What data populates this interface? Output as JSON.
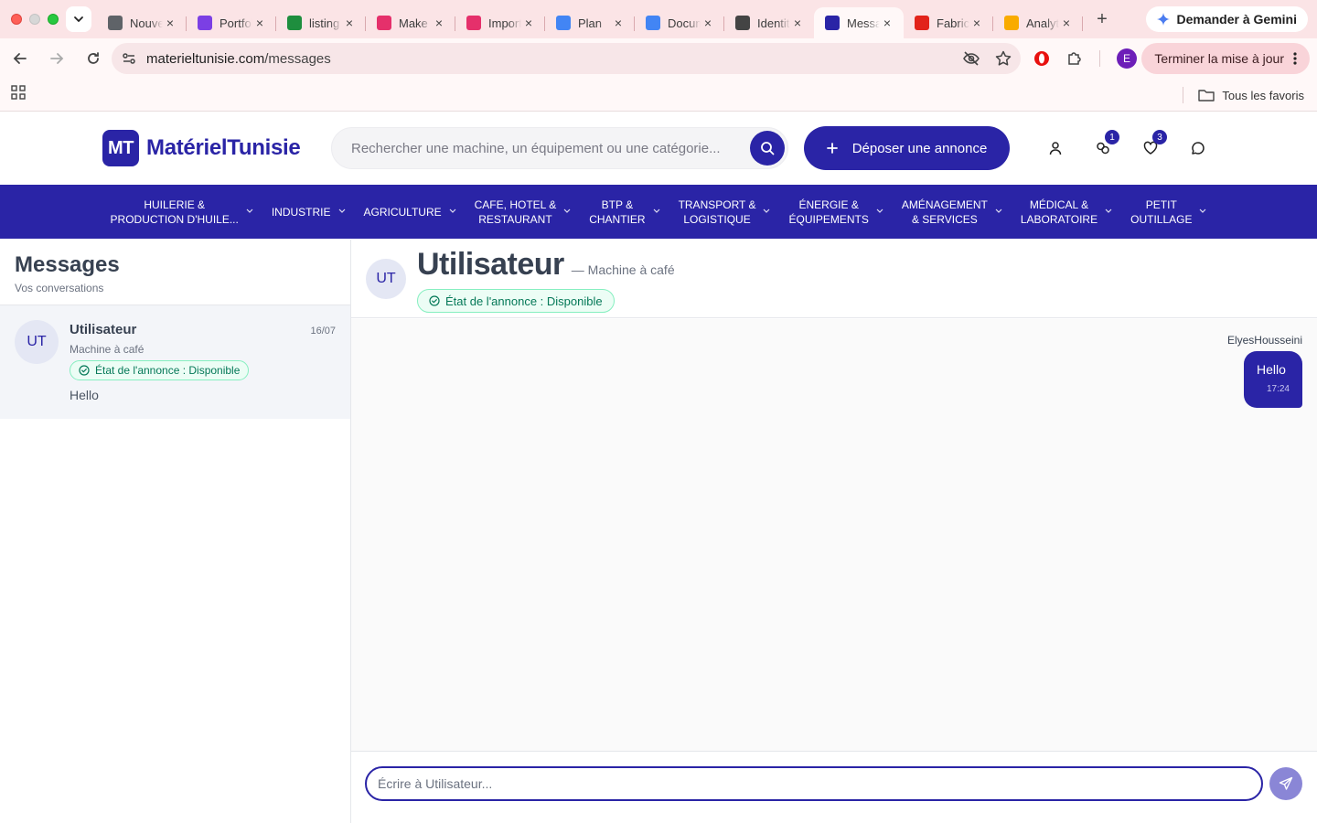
{
  "browser": {
    "tabs": [
      {
        "label": "Nouvel onglet",
        "icon": "chrome-icon",
        "color": "#5f6368"
      },
      {
        "label": "Portfolio",
        "icon": "h-logo-icon",
        "color": "#7b3fe4"
      },
      {
        "label": "listing",
        "icon": "sheet-icon",
        "color": "#1e8e3e"
      },
      {
        "label": "Make",
        "icon": "flow-icon",
        "color": "#e5306b"
      },
      {
        "label": "Import",
        "icon": "flow-icon",
        "color": "#e5306b"
      },
      {
        "label": "Plan",
        "icon": "doc-icon",
        "color": "#4285f4"
      },
      {
        "label": "Document",
        "icon": "doc-icon",
        "color": "#4285f4"
      },
      {
        "label": "Identité",
        "icon": "openai-icon",
        "color": "#444"
      },
      {
        "label": "Messages",
        "icon": "mt-icon",
        "color": "#2a24a6"
      },
      {
        "label": "Fabric",
        "icon": "t-icon",
        "color": "#e2231a"
      },
      {
        "label": "Analytics",
        "icon": "analytics-icon",
        "color": "#f9ab00"
      }
    ],
    "active_tab": 8,
    "gemini_label": "Demander à Gemini",
    "url_host": "materieltunisie.com",
    "url_path": "/messages",
    "update_label": "Terminer la mise à jour",
    "profile_initial": "E",
    "bookmarks_all_label": "Tous les favoris"
  },
  "site": {
    "logo_mark": "MT",
    "logo_text": "MatérielTunisie",
    "search_placeholder": "Rechercher une machine, un équipement ou une catégorie...",
    "post_label": "Déposer une annonce",
    "badges": {
      "compare": "1",
      "favorites": "3"
    }
  },
  "categories": [
    {
      "line1": "HUILERIE &",
      "line2": "PRODUCTION D'HUILE..."
    },
    {
      "line1": "INDUSTRIE",
      "line2": ""
    },
    {
      "line1": "AGRICULTURE",
      "line2": ""
    },
    {
      "line1": "CAFE, HOTEL &",
      "line2": "RESTAURANT"
    },
    {
      "line1": "BTP &",
      "line2": "CHANTIER"
    },
    {
      "line1": "TRANSPORT &",
      "line2": "LOGISTIQUE"
    },
    {
      "line1": "ÉNERGIE &",
      "line2": "ÉQUIPEMENTS"
    },
    {
      "line1": "AMÉNAGEMENT",
      "line2": "& SERVICES"
    },
    {
      "line1": "MÉDICAL &",
      "line2": "LABORATOIRE"
    },
    {
      "line1": "PETIT",
      "line2": "OUTILLAGE"
    }
  ],
  "messages": {
    "title": "Messages",
    "subtitle": "Vos conversations",
    "conversation": {
      "initials": "UT",
      "name": "Utilisateur",
      "date": "16/07",
      "item": "Machine à café",
      "status": "État de l'annonce : Disponible",
      "last_message": "Hello"
    }
  },
  "chat": {
    "initials": "UT",
    "name": "Utilisateur",
    "item": "— Machine à café",
    "status": "État de l'annonce : Disponible",
    "sender": "ElyesHousseini",
    "message_text": "Hello",
    "message_time": "17:24",
    "composer_placeholder": "Écrire à Utilisateur..."
  },
  "colors": {
    "brand": "#2a24a6",
    "success": "#047857"
  }
}
